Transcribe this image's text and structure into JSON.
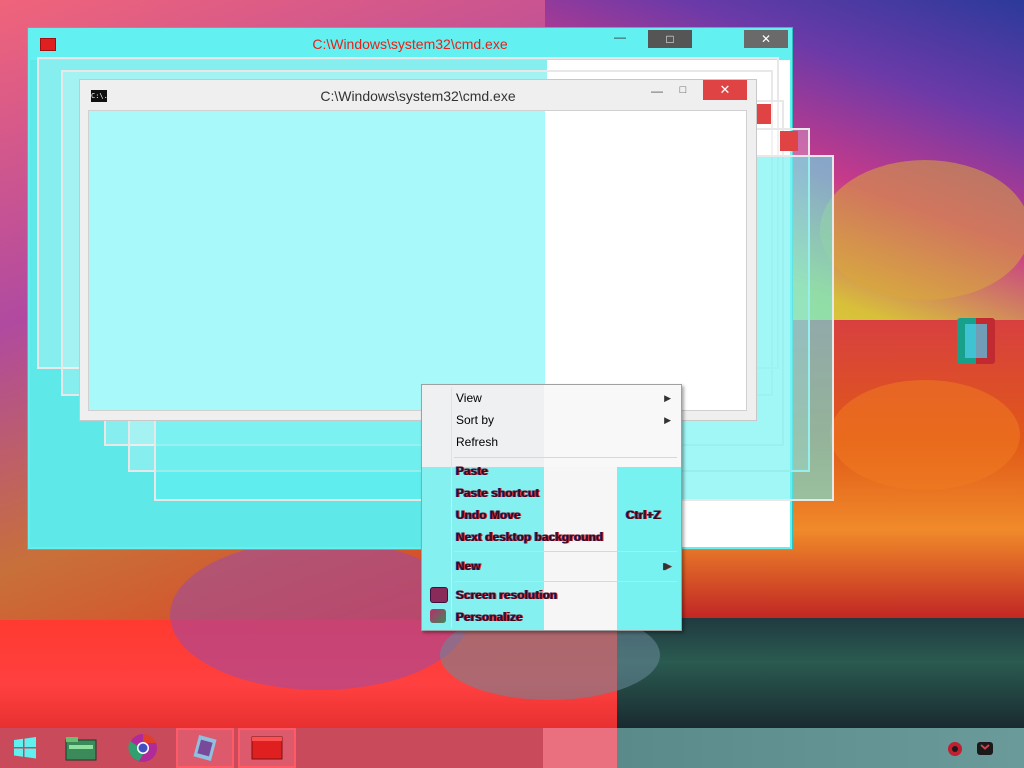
{
  "back_window": {
    "title": "C:\\Windows\\system32\\cmd.exe",
    "minimize": "—",
    "maximize": "□",
    "close": "✕"
  },
  "front_window": {
    "title": "C:\\Windows\\system32\\cmd.exe",
    "icon_text": "C:\\.",
    "minimize": "—",
    "maximize": "□",
    "close": "✕"
  },
  "context_menu": {
    "items": [
      {
        "label": "View",
        "submenu": true
      },
      {
        "label": "Sort by",
        "submenu": true
      },
      {
        "label": "Refresh"
      },
      {
        "label": "Paste"
      },
      {
        "label": "Paste shortcut"
      },
      {
        "label": "Undo Move",
        "shortcut": "Ctrl+Z"
      },
      {
        "label": "Next desktop background"
      },
      {
        "label": "New",
        "submenu": true
      },
      {
        "label": "Screen resolution",
        "icon": "display-icon"
      },
      {
        "label": "Personalize",
        "icon": "personalize-icon"
      }
    ],
    "submenu_arrow": "▶"
  },
  "desktop_icon": {
    "label": "",
    "icon": "application-icon"
  },
  "taskbar": {
    "start_icon": "windows-start-icon",
    "apps": [
      {
        "name": "file-explorer-icon",
        "active": false
      },
      {
        "name": "chrome-icon",
        "active": false
      },
      {
        "name": "paint-icon",
        "active": true
      },
      {
        "name": "cmd-icon",
        "active": true
      }
    ],
    "tray": [
      "network-icon",
      "volume-icon"
    ],
    "clock_time": "",
    "clock_date": ""
  },
  "colors": {
    "glitch_cyan": "#62f0f0",
    "close_red": "#e04343"
  }
}
